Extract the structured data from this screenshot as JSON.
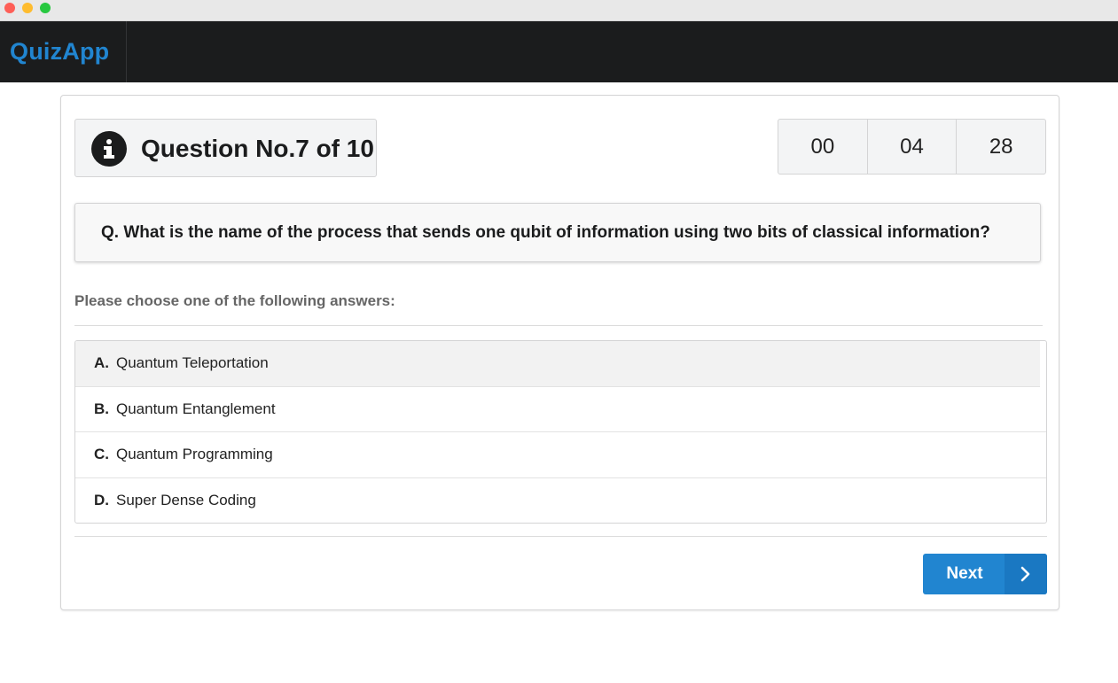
{
  "app": {
    "brand": "QuizApp"
  },
  "header": {
    "question_status": "Question No.7 of 10"
  },
  "timer": {
    "hours": "00",
    "minutes": "04",
    "seconds": "28"
  },
  "question": {
    "text": "Q. What is the name of the process that sends one qubit of information using two bits of classical information?"
  },
  "answers": {
    "prompt": "Please choose one of the following answers:",
    "options": [
      {
        "letter": "A.",
        "text": "Quantum Teleportation",
        "selected": true
      },
      {
        "letter": "B.",
        "text": "Quantum Entanglement",
        "selected": false
      },
      {
        "letter": "C.",
        "text": "Quantum Programming",
        "selected": false
      },
      {
        "letter": "D.",
        "text": "Super Dense Coding",
        "selected": false
      }
    ]
  },
  "actions": {
    "next_label": "Next"
  },
  "icons": {
    "info": "info-icon",
    "next": "chevron-right-icon"
  },
  "colors": {
    "brand": "#2185d0",
    "navbar": "#1b1c1d",
    "selected_row": "#f2f2f2"
  }
}
